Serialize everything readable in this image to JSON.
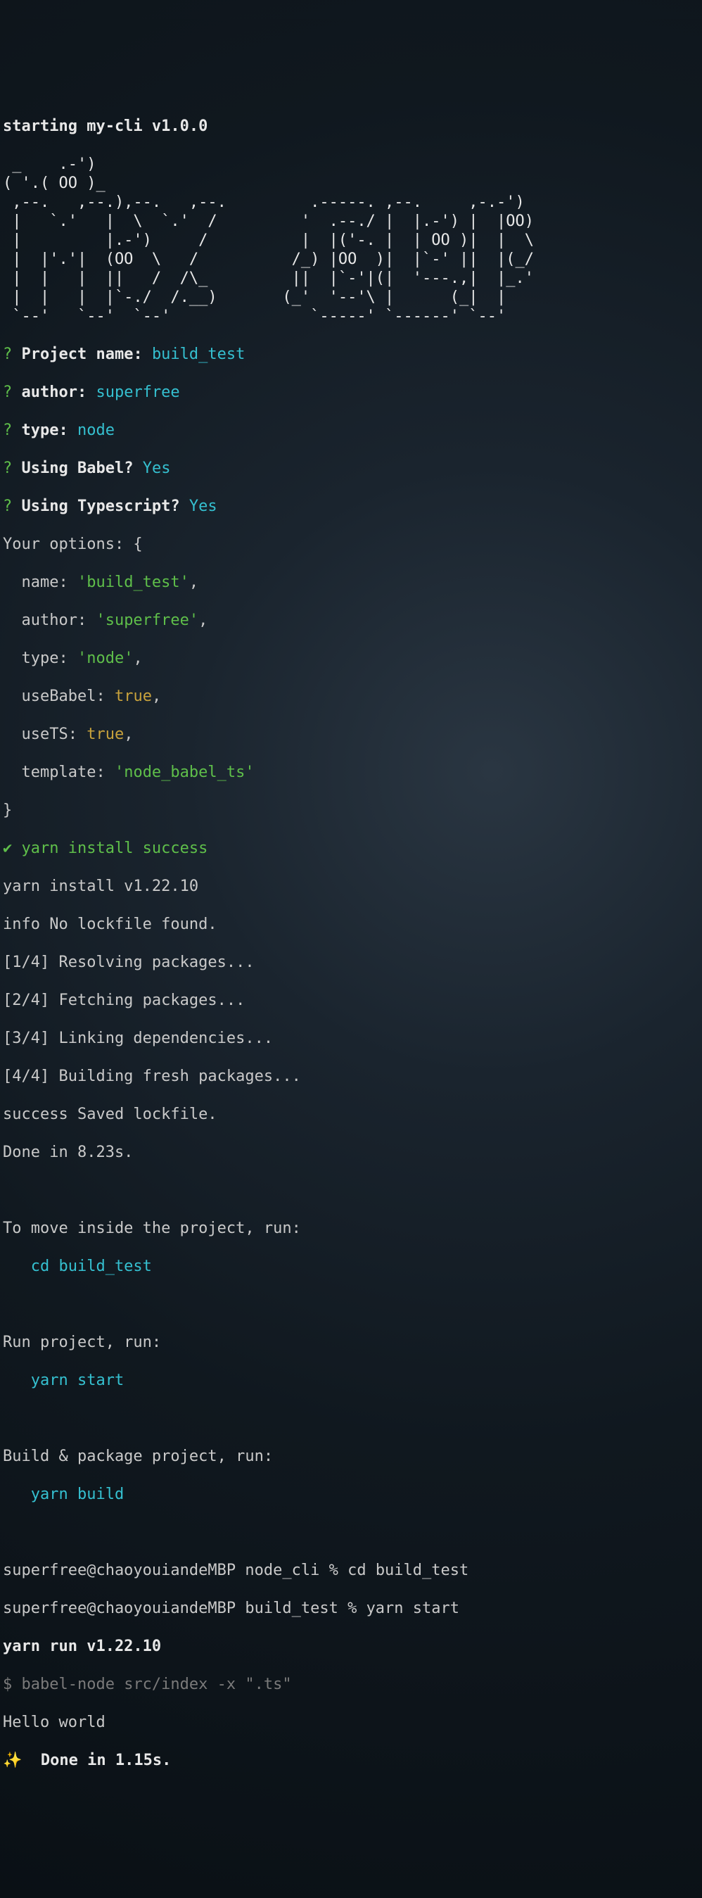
{
  "header": "starting my-cli v1.0.0",
  "ascii": " _    .-')                                           \n( '.( OO )_                                          \n ,--.   ,--.),--.   ,--.         .-----. ,--.     ,-.-')  \n |   `.'   |  \\  `.'  /         '  .--./ |  |.-') |  |OO) \n |         |.-')     /          |  |('-. |  | OO )|  |  \\ \n |  |'.'|  (OO  \\   /          /_) |OO  )|  |`-' ||  |(_/ \n |  |   |  ||   /  /\\_         ||  |`-'|(|  '---.,|  |_.' \n |  |   |  |`-./  /.__)       (_'  '--'\\ |      (_|  |    \n `--'   `--'  `--'               `-----' `------' `--'    ",
  "prompts": {
    "marker": "?",
    "project_name": {
      "label": "Project name:",
      "value": "build_test"
    },
    "author": {
      "label": "author:",
      "value": "superfree"
    },
    "type": {
      "label": "type:",
      "value": "node"
    },
    "babel": {
      "label": "Using Babel?",
      "value": "Yes"
    },
    "ts": {
      "label": "Using Typescript?",
      "value": "Yes"
    }
  },
  "options_header": "Your options: {",
  "options": {
    "name": {
      "key": "  name: ",
      "val": "'build_test'",
      "comma": ","
    },
    "author": {
      "key": "  author: ",
      "val": "'superfree'",
      "comma": ","
    },
    "type": {
      "key": "  type: ",
      "val": "'node'",
      "comma": ","
    },
    "useBabel": {
      "key": "  useBabel: ",
      "val": "true",
      "comma": ","
    },
    "useTS": {
      "key": "  useTS: ",
      "val": "true",
      "comma": ","
    },
    "template": {
      "key": "  template: ",
      "val": "'node_babel_ts'",
      "comma": ""
    }
  },
  "options_close": "}",
  "install": {
    "check": "✔",
    "success": " yarn install success",
    "version": "yarn install v1.22.10",
    "nolock": "info No lockfile found.",
    "steps": [
      "[1/4] Resolving packages...",
      "[2/4] Fetching packages...",
      "[3/4] Linking dependencies...",
      "[4/4] Building fresh packages..."
    ],
    "saved": "success Saved lockfile.",
    "done": "Done in 8.23s."
  },
  "guide": {
    "move_label": "To move inside the project, run:",
    "move_cmd": "   cd build_test",
    "run_label": "Run project, run:",
    "run_cmd": "   yarn start",
    "build_label": "Build & package project, run:",
    "build_cmd": "   yarn build"
  },
  "shell": {
    "line1": {
      "prompt": "superfree@chaoyouiandeMBP node_cli % ",
      "cmd": "cd build_test"
    },
    "line2": {
      "prompt": "superfree@chaoyouiandeMBP build_test % ",
      "cmd": "yarn start"
    }
  },
  "run": {
    "header": "yarn run v1.22.10",
    "dollar": "$ ",
    "cmd": "babel-node src/index -x \".ts\"",
    "out": "Hello world",
    "sparkle": "✨  ",
    "done": "Done in 1.15s."
  }
}
